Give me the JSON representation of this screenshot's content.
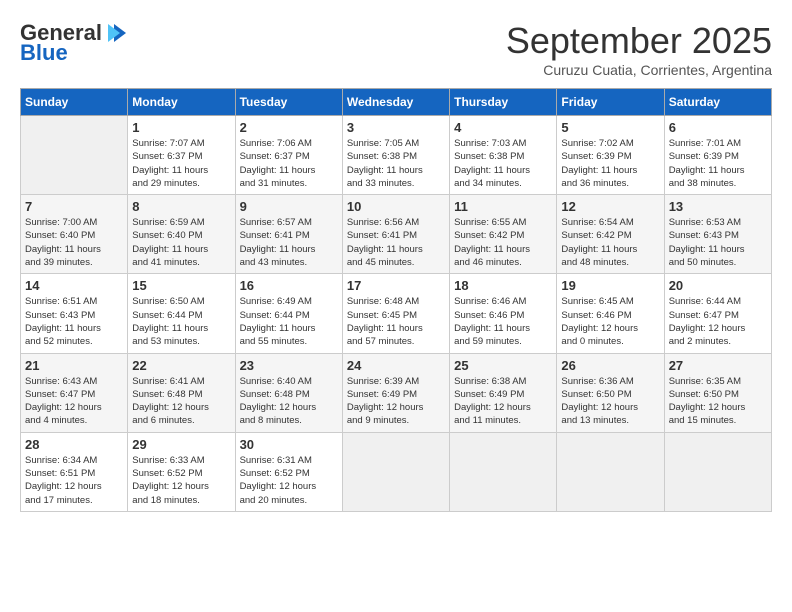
{
  "header": {
    "logo_general": "General",
    "logo_blue": "Blue",
    "month_year": "September 2025",
    "location": "Curuzu Cuatia, Corrientes, Argentina"
  },
  "days_of_week": [
    "Sunday",
    "Monday",
    "Tuesday",
    "Wednesday",
    "Thursday",
    "Friday",
    "Saturday"
  ],
  "weeks": [
    [
      {
        "day": "",
        "info": ""
      },
      {
        "day": "1",
        "info": "Sunrise: 7:07 AM\nSunset: 6:37 PM\nDaylight: 11 hours\nand 29 minutes."
      },
      {
        "day": "2",
        "info": "Sunrise: 7:06 AM\nSunset: 6:37 PM\nDaylight: 11 hours\nand 31 minutes."
      },
      {
        "day": "3",
        "info": "Sunrise: 7:05 AM\nSunset: 6:38 PM\nDaylight: 11 hours\nand 33 minutes."
      },
      {
        "day": "4",
        "info": "Sunrise: 7:03 AM\nSunset: 6:38 PM\nDaylight: 11 hours\nand 34 minutes."
      },
      {
        "day": "5",
        "info": "Sunrise: 7:02 AM\nSunset: 6:39 PM\nDaylight: 11 hours\nand 36 minutes."
      },
      {
        "day": "6",
        "info": "Sunrise: 7:01 AM\nSunset: 6:39 PM\nDaylight: 11 hours\nand 38 minutes."
      }
    ],
    [
      {
        "day": "7",
        "info": "Sunrise: 7:00 AM\nSunset: 6:40 PM\nDaylight: 11 hours\nand 39 minutes."
      },
      {
        "day": "8",
        "info": "Sunrise: 6:59 AM\nSunset: 6:40 PM\nDaylight: 11 hours\nand 41 minutes."
      },
      {
        "day": "9",
        "info": "Sunrise: 6:57 AM\nSunset: 6:41 PM\nDaylight: 11 hours\nand 43 minutes."
      },
      {
        "day": "10",
        "info": "Sunrise: 6:56 AM\nSunset: 6:41 PM\nDaylight: 11 hours\nand 45 minutes."
      },
      {
        "day": "11",
        "info": "Sunrise: 6:55 AM\nSunset: 6:42 PM\nDaylight: 11 hours\nand 46 minutes."
      },
      {
        "day": "12",
        "info": "Sunrise: 6:54 AM\nSunset: 6:42 PM\nDaylight: 11 hours\nand 48 minutes."
      },
      {
        "day": "13",
        "info": "Sunrise: 6:53 AM\nSunset: 6:43 PM\nDaylight: 11 hours\nand 50 minutes."
      }
    ],
    [
      {
        "day": "14",
        "info": "Sunrise: 6:51 AM\nSunset: 6:43 PM\nDaylight: 11 hours\nand 52 minutes."
      },
      {
        "day": "15",
        "info": "Sunrise: 6:50 AM\nSunset: 6:44 PM\nDaylight: 11 hours\nand 53 minutes."
      },
      {
        "day": "16",
        "info": "Sunrise: 6:49 AM\nSunset: 6:44 PM\nDaylight: 11 hours\nand 55 minutes."
      },
      {
        "day": "17",
        "info": "Sunrise: 6:48 AM\nSunset: 6:45 PM\nDaylight: 11 hours\nand 57 minutes."
      },
      {
        "day": "18",
        "info": "Sunrise: 6:46 AM\nSunset: 6:46 PM\nDaylight: 11 hours\nand 59 minutes."
      },
      {
        "day": "19",
        "info": "Sunrise: 6:45 AM\nSunset: 6:46 PM\nDaylight: 12 hours\nand 0 minutes."
      },
      {
        "day": "20",
        "info": "Sunrise: 6:44 AM\nSunset: 6:47 PM\nDaylight: 12 hours\nand 2 minutes."
      }
    ],
    [
      {
        "day": "21",
        "info": "Sunrise: 6:43 AM\nSunset: 6:47 PM\nDaylight: 12 hours\nand 4 minutes."
      },
      {
        "day": "22",
        "info": "Sunrise: 6:41 AM\nSunset: 6:48 PM\nDaylight: 12 hours\nand 6 minutes."
      },
      {
        "day": "23",
        "info": "Sunrise: 6:40 AM\nSunset: 6:48 PM\nDaylight: 12 hours\nand 8 minutes."
      },
      {
        "day": "24",
        "info": "Sunrise: 6:39 AM\nSunset: 6:49 PM\nDaylight: 12 hours\nand 9 minutes."
      },
      {
        "day": "25",
        "info": "Sunrise: 6:38 AM\nSunset: 6:49 PM\nDaylight: 12 hours\nand 11 minutes."
      },
      {
        "day": "26",
        "info": "Sunrise: 6:36 AM\nSunset: 6:50 PM\nDaylight: 12 hours\nand 13 minutes."
      },
      {
        "day": "27",
        "info": "Sunrise: 6:35 AM\nSunset: 6:50 PM\nDaylight: 12 hours\nand 15 minutes."
      }
    ],
    [
      {
        "day": "28",
        "info": "Sunrise: 6:34 AM\nSunset: 6:51 PM\nDaylight: 12 hours\nand 17 minutes."
      },
      {
        "day": "29",
        "info": "Sunrise: 6:33 AM\nSunset: 6:52 PM\nDaylight: 12 hours\nand 18 minutes."
      },
      {
        "day": "30",
        "info": "Sunrise: 6:31 AM\nSunset: 6:52 PM\nDaylight: 12 hours\nand 20 minutes."
      },
      {
        "day": "",
        "info": ""
      },
      {
        "day": "",
        "info": ""
      },
      {
        "day": "",
        "info": ""
      },
      {
        "day": "",
        "info": ""
      }
    ]
  ]
}
